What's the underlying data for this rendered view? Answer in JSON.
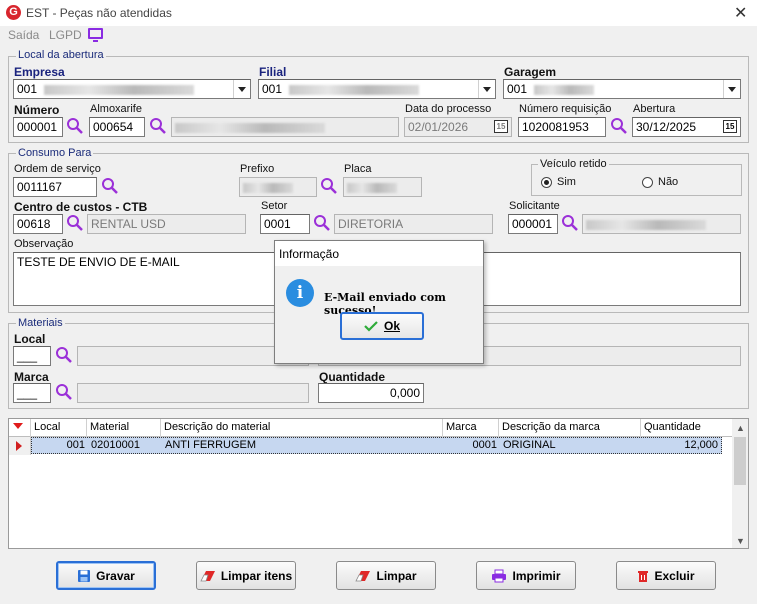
{
  "window": {
    "title": "EST - Peças não atendidas",
    "logo": "G"
  },
  "menu": {
    "items": [
      "Saída",
      "LGPD"
    ]
  },
  "abertura": {
    "group_title": "Local da abertura",
    "empresa": {
      "label": "Empresa",
      "value": "001"
    },
    "filial": {
      "label": "Filial",
      "value": "001"
    },
    "garagem": {
      "label": "Garagem",
      "value": "001"
    },
    "numero": {
      "label": "Número",
      "value": "000001"
    },
    "almoxarife": {
      "label": "Almoxarife",
      "value": "000654"
    },
    "data_processo": {
      "label": "Data do processo",
      "value": "02/01/2026"
    },
    "numero_requisicao": {
      "label": "Número requisição",
      "value": "1020081953"
    },
    "abertura": {
      "label": "Abertura",
      "value": "30/12/2025"
    }
  },
  "consumo": {
    "group_title": "Consumo Para",
    "ordem_servico": {
      "label": "Ordem de serviço",
      "value": "0011167"
    },
    "prefixo": {
      "label": "Prefixo"
    },
    "placa": {
      "label": "Placa"
    },
    "veiculo_retido": {
      "label": "Veículo retido",
      "sim": "Sim",
      "nao": "Não",
      "selected": "Sim"
    },
    "centro_custos": {
      "label": "Centro de custos - CTB",
      "code": "00618",
      "desc": "RENTAL USD"
    },
    "setor": {
      "label": "Setor",
      "code": "0001",
      "desc": "DIRETORIA"
    },
    "solicitante": {
      "label": "Solicitante",
      "code": "000001"
    },
    "observacao": {
      "label": "Observação",
      "value": "TESTE DE ENVIO DE E-MAIL"
    }
  },
  "materiais": {
    "group_title": "Materiais",
    "local_label": "Local",
    "local_value": "___",
    "marca_label": "Marca",
    "marca_value": "___",
    "quantidade_label": "Quantidade",
    "quantidade_value": "0,000"
  },
  "grid": {
    "columns": [
      "Local",
      "Material",
      "Descrição do material",
      "Marca",
      "Descrição da marca",
      "Quantidade"
    ],
    "rows": [
      {
        "local": "001",
        "material": "02010001",
        "descricao": "ANTI FERRUGEM",
        "marca": "0001",
        "descricao_marca": "ORIGINAL",
        "quantidade": "12,000"
      }
    ]
  },
  "buttons": {
    "gravar": "Gravar",
    "limpar_itens": "Limpar itens",
    "limpar": "Limpar",
    "imprimir": "Imprimir",
    "excluir": "Excluir"
  },
  "dialog": {
    "title": "Informação",
    "message": "E-Mail enviado com sucesso!",
    "ok": "Ok"
  },
  "colors": {
    "accent": "#8a2be2",
    "search_icon": "#9b30d8",
    "selection": "#c6d7f0",
    "info": "#2a8de0",
    "focus": "#2a6fd6"
  }
}
